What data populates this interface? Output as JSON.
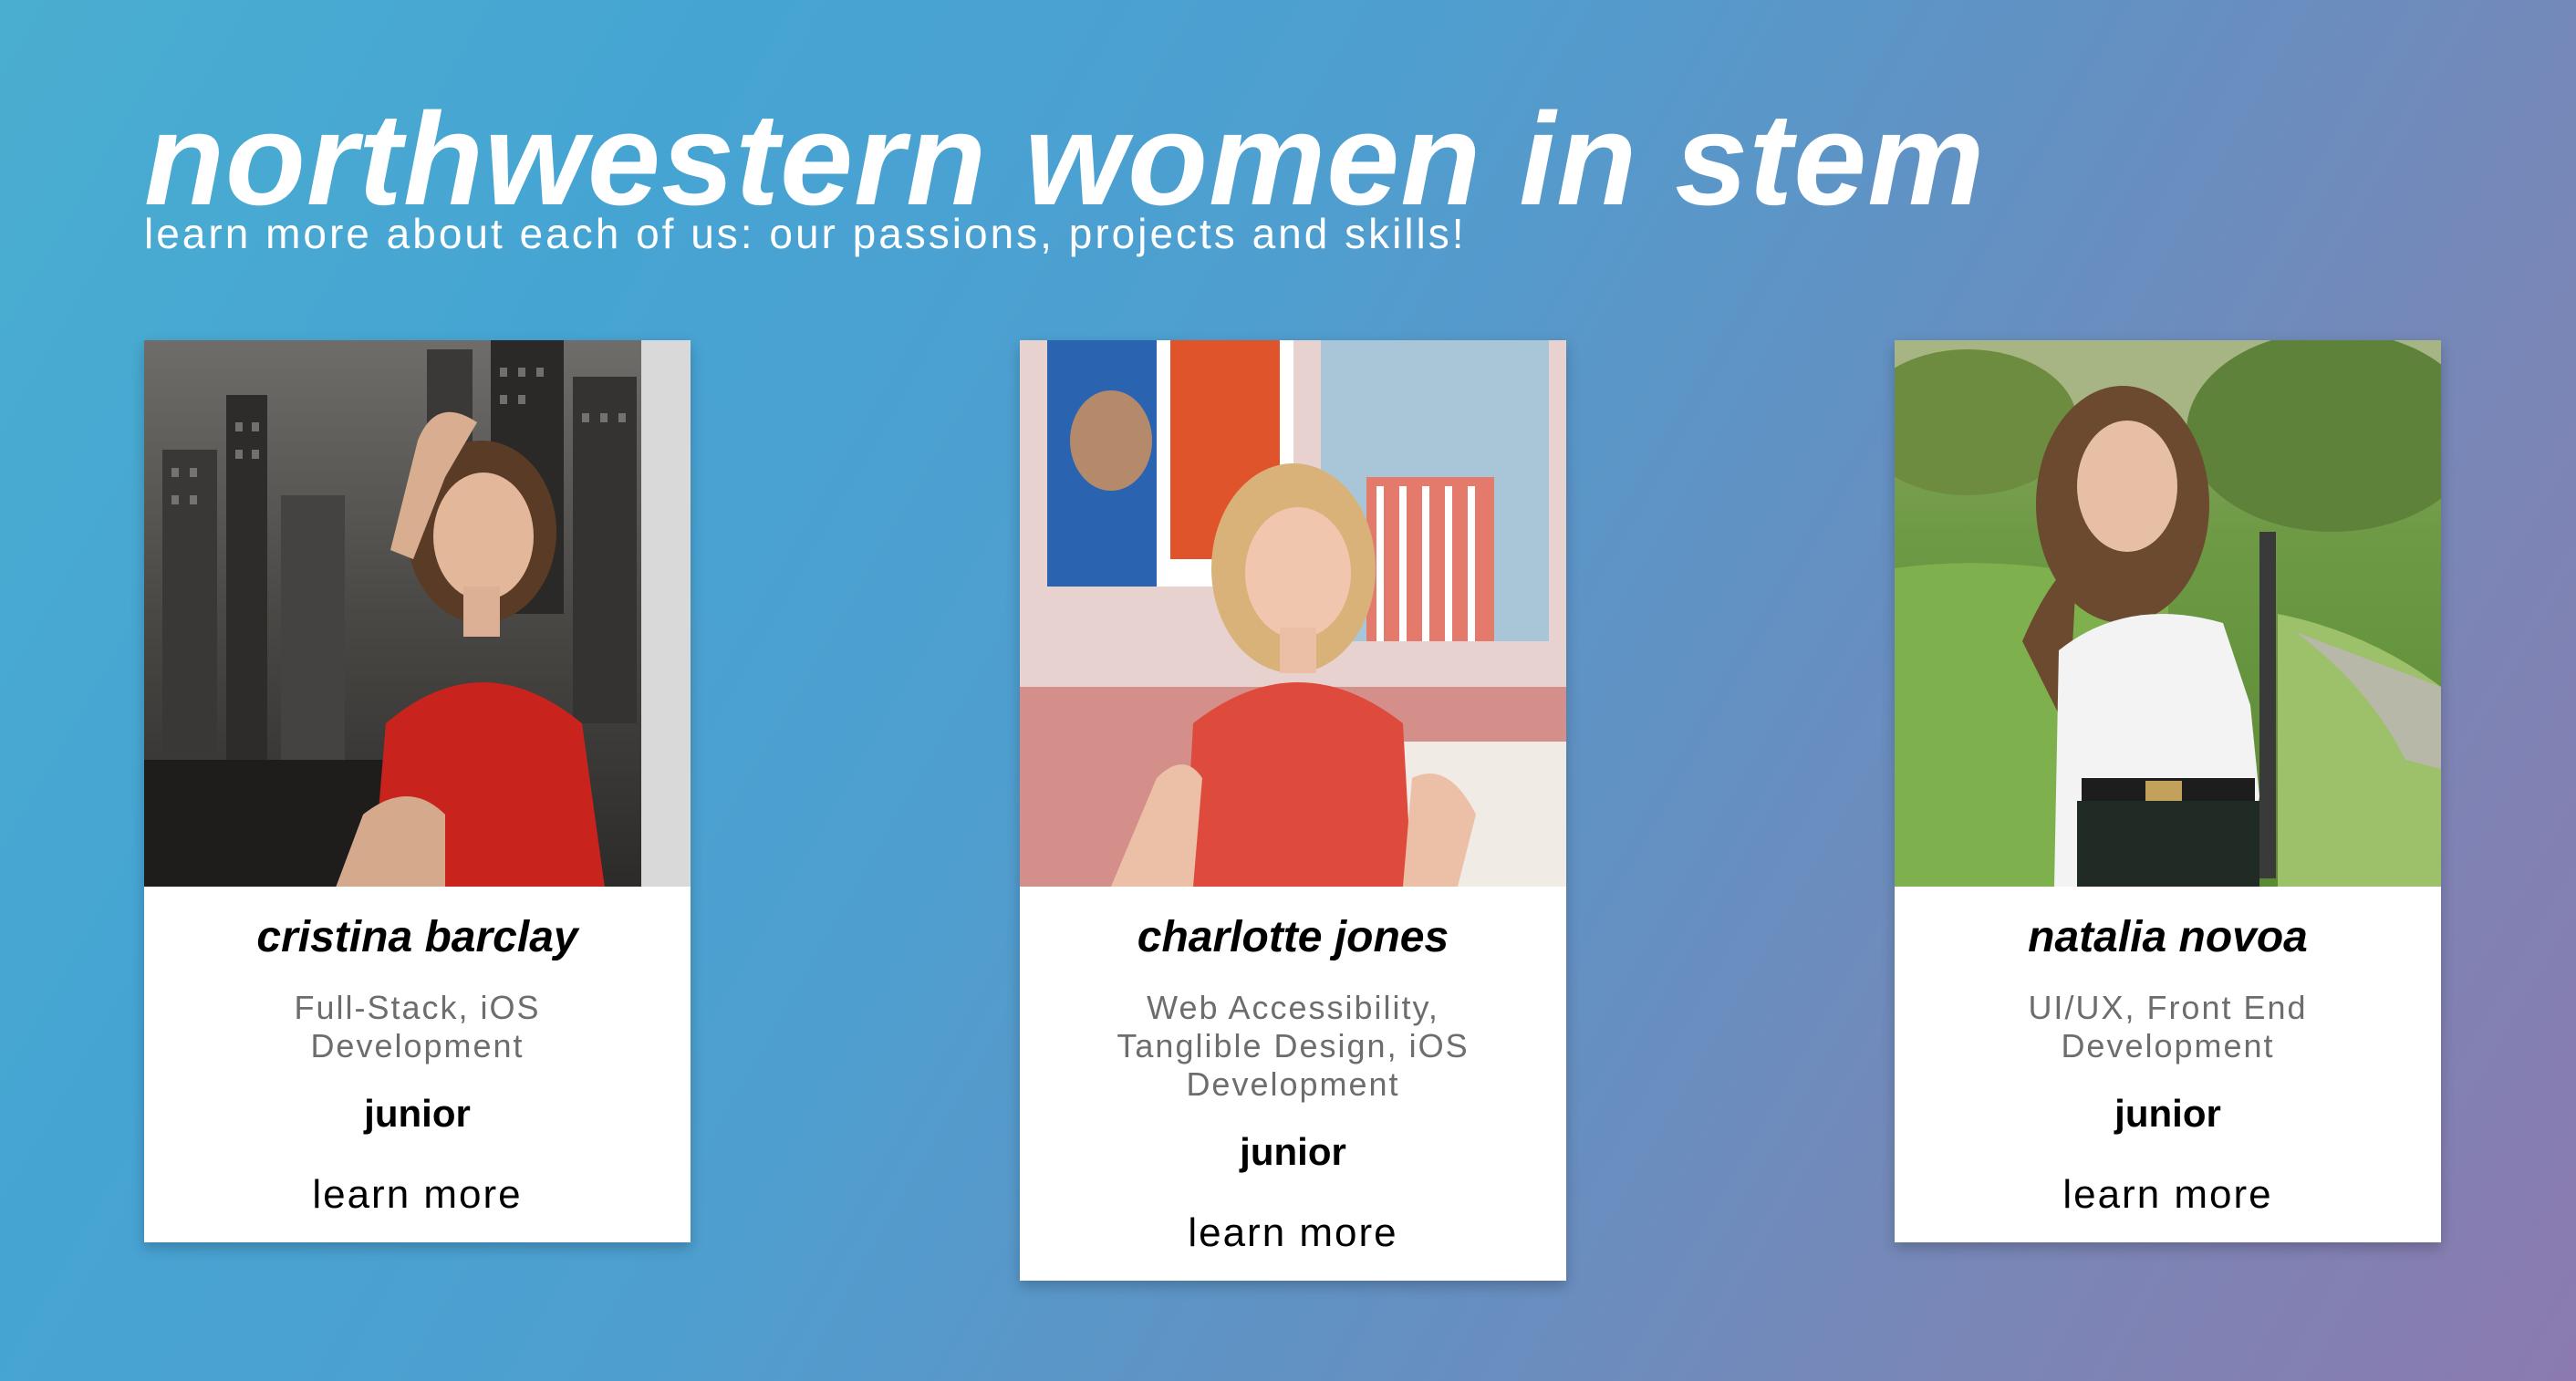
{
  "header": {
    "title": "northwestern women in stem",
    "subtitle": "learn more about each of us: our passions, projects and skills!"
  },
  "members": [
    {
      "name": "cristina barclay",
      "skills": "Full-Stack, iOS Development",
      "year": "junior",
      "link_label": "learn more"
    },
    {
      "name": "charlotte jones",
      "skills": "Web Accessibility, Tanglible Design, iOS Development",
      "year": "junior",
      "link_label": "learn more"
    },
    {
      "name": "natalia novoa",
      "skills": "UI/UX, Front End Development",
      "year": "junior",
      "link_label": "learn more"
    }
  ],
  "colors": {
    "gradient_start": "#4aaed0",
    "gradient_end": "#8b7ab0",
    "card_background": "#ffffff",
    "skills_text": "#6d6d6d"
  }
}
